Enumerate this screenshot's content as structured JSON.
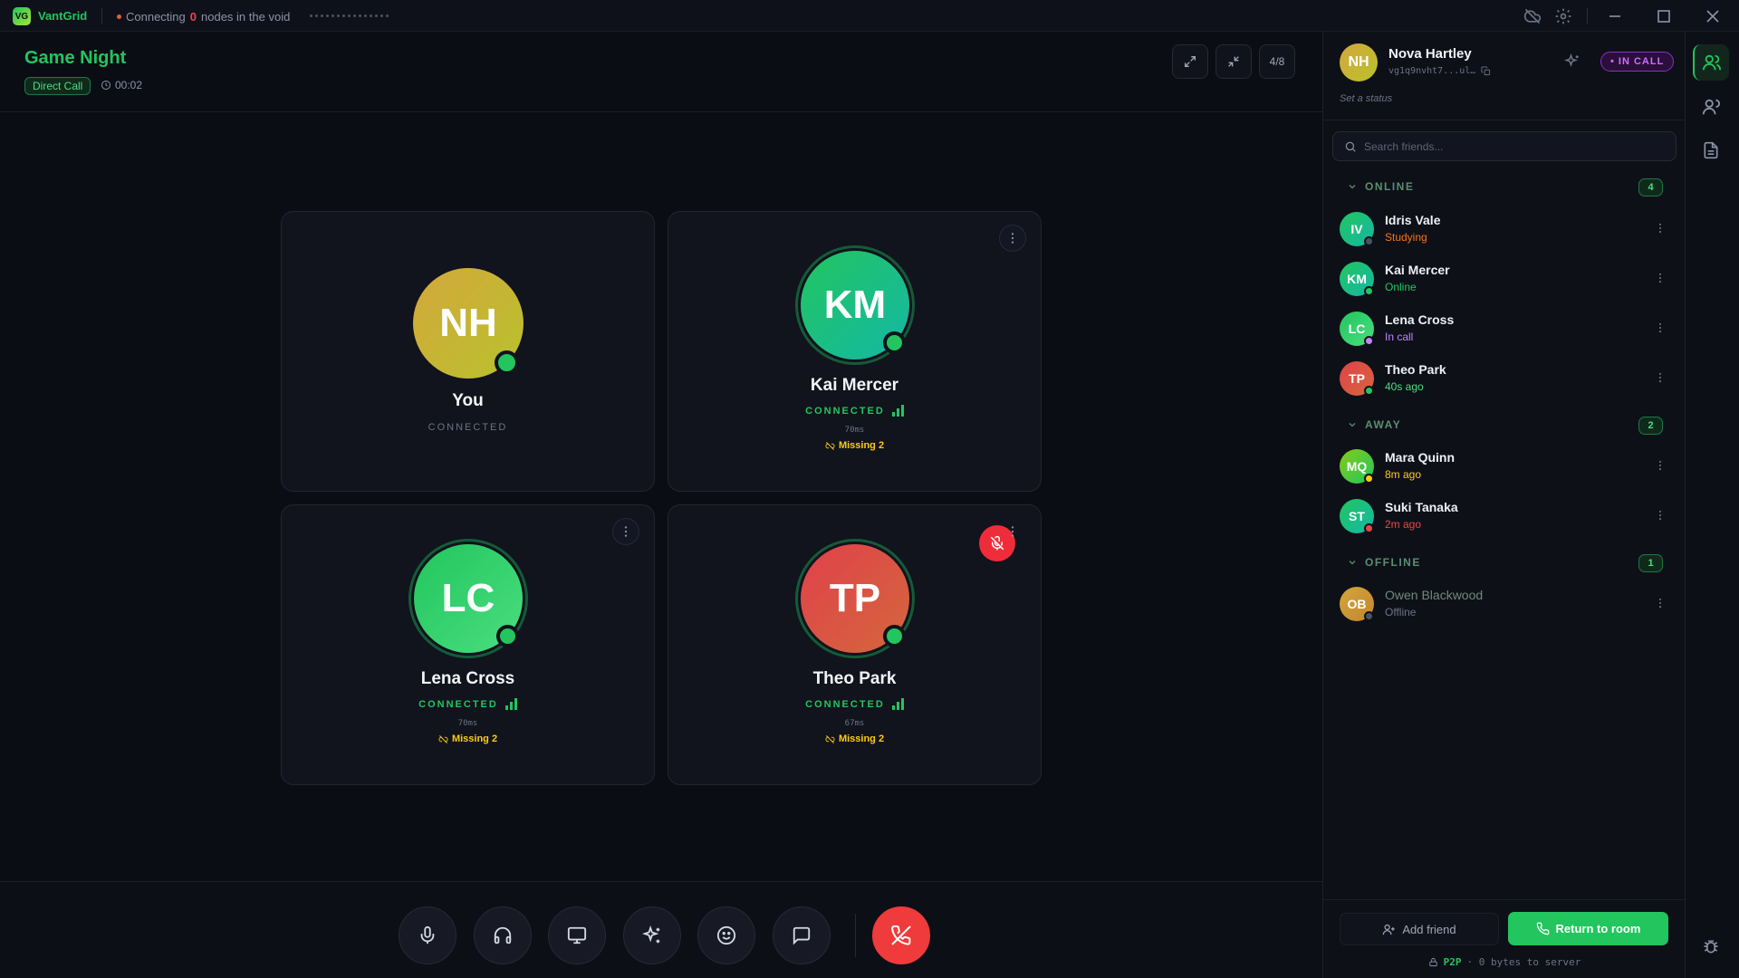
{
  "app": {
    "logo": "VG",
    "name": "VantGrid"
  },
  "titlebar": {
    "status_prefix": "Connecting",
    "status_count": "0",
    "status_suffix": "nodes in the void"
  },
  "room": {
    "title": "Game Night",
    "badge": "Direct Call",
    "timer": "00:02",
    "count": "4/8"
  },
  "tiles": [
    {
      "initials": "NH",
      "name": "You",
      "status": "CONNECTED",
      "status_color": "#6b7385",
      "gradient": [
        "#d4a73c",
        "#b8c22c"
      ]
    },
    {
      "initials": "KM",
      "name": "Kai Mercer",
      "status": "CONNECTED",
      "ping": "70ms",
      "missing": "Missing 2",
      "gradient": [
        "#22c55e",
        "#14b8a6"
      ]
    },
    {
      "initials": "LC",
      "name": "Lena Cross",
      "status": "CONNECTED",
      "ping": "70ms",
      "missing": "Missing 2",
      "gradient": [
        "#22c55e",
        "#4ade80"
      ]
    },
    {
      "initials": "TP",
      "name": "Theo Park",
      "status": "CONNECTED",
      "ping": "67ms",
      "missing": "Missing 2",
      "muted": true,
      "gradient": [
        "#e0414b",
        "#d4673c"
      ]
    }
  ],
  "controls": [
    "microphone",
    "headphones",
    "screen-share",
    "effects",
    "emoji",
    "chat",
    "end-call"
  ],
  "profile": {
    "initials": "NH",
    "name": "Nova Hartley",
    "id": "vg1q9nvht7...ul…",
    "status_placeholder": "Set a status",
    "badge": "• IN CALL"
  },
  "search": {
    "placeholder": "Search friends..."
  },
  "groups": {
    "online": {
      "label": "ONLINE",
      "count": "4"
    },
    "away": {
      "label": "AWAY",
      "count": "2"
    },
    "offline": {
      "label": "OFFLINE",
      "count": "1"
    }
  },
  "friends": [
    {
      "initials": "IV",
      "name": "Idris Vale",
      "sub": "Studying",
      "sub_color": "#f97316",
      "dot": "#4b5263",
      "gradient": [
        "#22c55e",
        "#14b8a6"
      ]
    },
    {
      "initials": "KM",
      "name": "Kai Mercer",
      "sub": "Online",
      "sub_color": "#22c55e",
      "dot": "#22c55e",
      "gradient": [
        "#22c55e",
        "#14b8a6"
      ]
    },
    {
      "initials": "LC",
      "name": "Lena Cross",
      "sub": "In call",
      "sub_color": "#c084fc",
      "dot": "#c084fc",
      "gradient": [
        "#22c55e",
        "#4ade80"
      ]
    },
    {
      "initials": "TP",
      "name": "Theo Park",
      "sub": "40s ago",
      "sub_color": "#4ade80",
      "dot": "#22c55e",
      "gradient": [
        "#e0414b",
        "#d4673c"
      ]
    },
    {
      "initials": "MQ",
      "name": "Mara Quinn",
      "sub": "8m ago",
      "sub_color": "#facc15",
      "dot": "#facc15",
      "gradient": [
        "#84cc16",
        "#22c55e"
      ]
    },
    {
      "initials": "ST",
      "name": "Suki Tanaka",
      "sub": "2m ago",
      "sub_color": "#ef4444",
      "dot": "#ef4444",
      "gradient": [
        "#22c55e",
        "#14b8a6"
      ]
    },
    {
      "initials": "OB",
      "name": "Owen Blackwood",
      "sub": "Offline",
      "sub_color": "#6b7385",
      "dot": "#4b5263",
      "gradient": [
        "#d4a73c",
        "#c2852c"
      ],
      "dim": true
    }
  ],
  "footer": {
    "add_friend": "Add friend",
    "return": "Return to room",
    "p2p_label": "P2P",
    "p2p_text": "· 0 bytes to server"
  }
}
